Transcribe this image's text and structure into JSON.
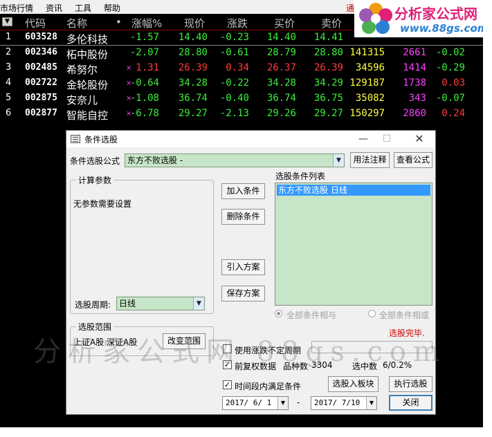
{
  "menu": {
    "items": [
      "市场行情",
      "资讯",
      "工具",
      "帮助"
    ],
    "red_item": "通"
  },
  "logo": {
    "title": "分析家公式网",
    "url": "www.88gs.com"
  },
  "grid": {
    "headers": [
      "代码",
      "名称",
      "•",
      "涨幅%",
      "现价",
      "涨跌",
      "买价",
      "卖价"
    ],
    "rows": [
      {
        "idx": "1",
        "code": "603528",
        "name": "多伦科技",
        "mark": "",
        "chg": "-1.57",
        "price": "14.40",
        "diff": "-0.23",
        "bid": "14.40",
        "ask": "14.41",
        "vol": "",
        "cur": "",
        "rate": ""
      },
      {
        "idx": "2",
        "code": "002346",
        "name": "柘中股份",
        "mark": "",
        "chg": "-2.07",
        "price": "28.80",
        "diff": "-0.61",
        "bid": "28.79",
        "ask": "28.80",
        "vol": "141315",
        "cur": "2661",
        "rate": "-0.02"
      },
      {
        "idx": "3",
        "code": "002485",
        "name": "希努尔",
        "mark": "×",
        "chg": "1.31",
        "price": "26.39",
        "diff": "0.34",
        "bid": "26.37",
        "ask": "26.39",
        "vol": "34596",
        "cur": "1414",
        "rate": "-0.29"
      },
      {
        "idx": "4",
        "code": "002722",
        "name": "金轮股份",
        "mark": "×",
        "chg": "-0.64",
        "price": "34.28",
        "diff": "-0.22",
        "bid": "34.28",
        "ask": "34.29",
        "vol": "129187",
        "cur": "1738",
        "rate": "0.03"
      },
      {
        "idx": "5",
        "code": "002875",
        "name": "安奈儿",
        "mark": "×",
        "chg": "-1.08",
        "price": "36.74",
        "diff": "-0.40",
        "bid": "36.74",
        "ask": "36.75",
        "vol": "35082",
        "cur": "343",
        "rate": "-0.07"
      },
      {
        "idx": "6",
        "code": "002877",
        "name": "智能自控",
        "mark": "×",
        "chg": "-6.78",
        "price": "29.27",
        "diff": "-2.13",
        "bid": "29.26",
        "ask": "29.27",
        "vol": "150297",
        "cur": "2860",
        "rate": "0.24"
      }
    ]
  },
  "watermark": "分析家公式网  88gs.com",
  "dialog": {
    "title": "条件选股",
    "formula_label": "条件选股公式",
    "formula_value": "东方不败选股 -",
    "btn_usage": "用法注释",
    "btn_view": "查看公式",
    "calc_params_label": "计算参数",
    "no_params": "无参数需要设置",
    "period_label": "选股周期:",
    "period_value": "日线",
    "btn_add": "加入条件",
    "btn_delete": "删除条件",
    "btn_import": "引入方案",
    "btn_save": "保存方案",
    "cond_list_label": "选股条件列表",
    "cond_item": "东方不败选股  日线",
    "radio_and": "全部条件相与",
    "radio_or": "全部条件相或",
    "status": "选股完毕.",
    "range_label": "选股范围",
    "range_value": "上证A股 深证A股",
    "btn_change_range": "改变范围",
    "chk_uncertain": "使用涨跌不定周期",
    "chk_restore": "前复权数据",
    "stock_count_label": "品种数",
    "stock_count": "3304",
    "selected_label": "选中数",
    "selected_value": "6/0.2%",
    "chk_period": "时间段内满足条件",
    "btn_to_block": "选股入板块",
    "btn_execute": "执行选股",
    "date_from": "2017/ 6/ 1",
    "date_sep": "-",
    "date_to": "2017/ 7/10",
    "btn_close": "关闭"
  },
  "colors": {
    "up": "#ff3c3c",
    "down": "#3cf03c",
    "selection": "#3399ff",
    "list_bg": "#c7e5c7"
  }
}
